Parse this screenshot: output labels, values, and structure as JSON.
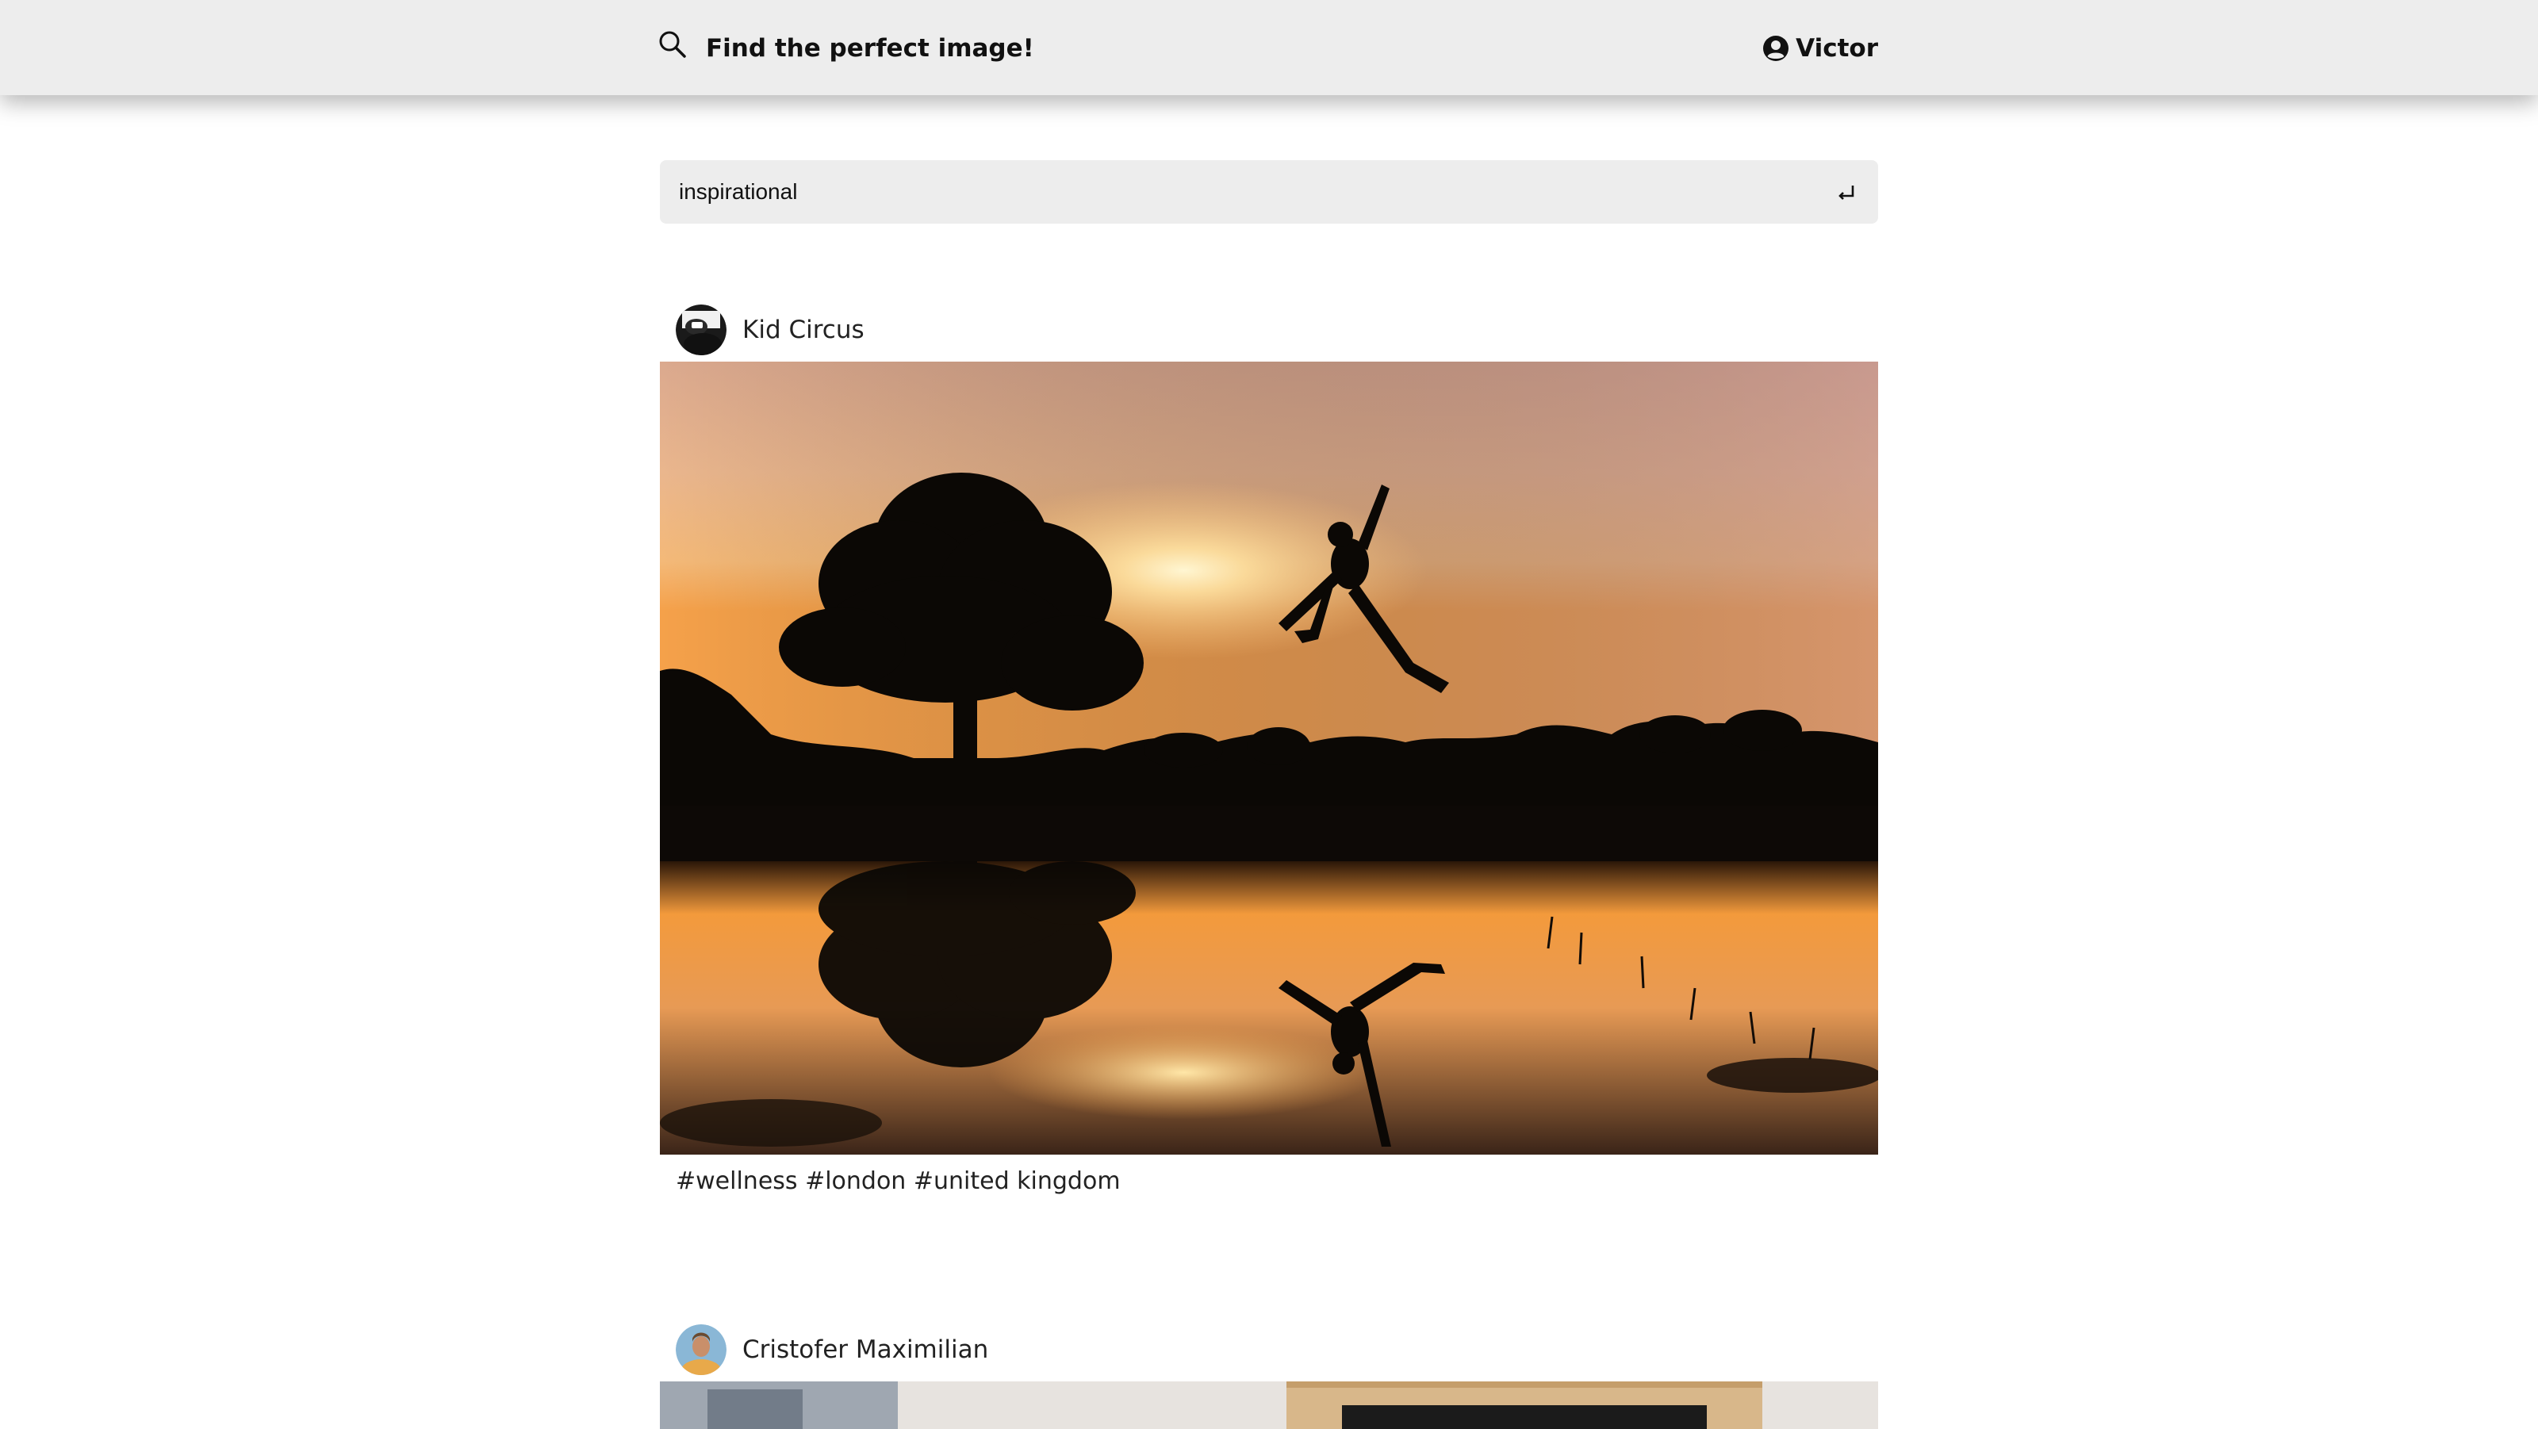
{
  "header": {
    "title": "Find the perfect image!",
    "search_icon": "search-icon",
    "user_icon": "user-circle-icon",
    "user_name": "Victor"
  },
  "search": {
    "value": "inspirational",
    "submit_icon": "enter-icon"
  },
  "posts": [
    {
      "author": "Kid Circus",
      "image_alt": "Silhouette of a person jumping at sunset next to a large tree, reflected in a puddle",
      "tags": "#wellness #london #united kingdom"
    },
    {
      "author": "Cristofer Maximilian",
      "image_alt": "Partially visible photo of a wooden frame",
      "tags": ""
    }
  ],
  "colors": {
    "header_bg": "#ededed",
    "search_bg": "#ededed",
    "text": "#111111"
  }
}
